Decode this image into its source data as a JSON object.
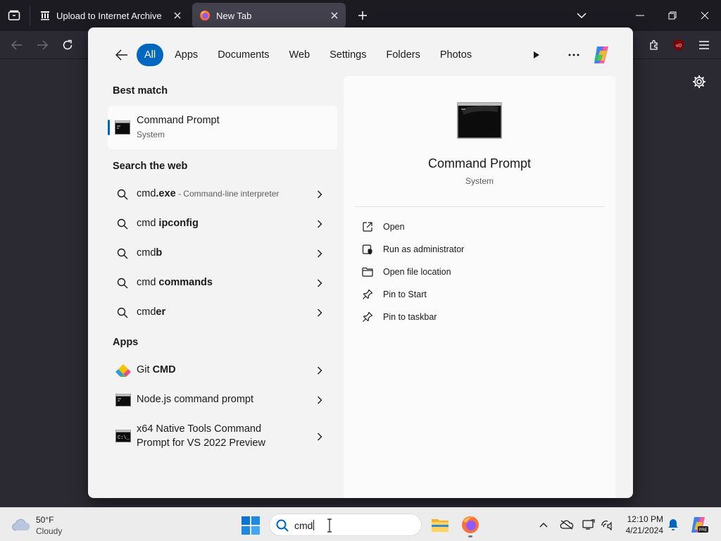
{
  "browser": {
    "tabs": [
      {
        "label": "Upload to Internet Archive",
        "icon": "archive-icon",
        "active": false
      },
      {
        "label": "New Tab",
        "icon": "firefox-icon",
        "active": true
      }
    ]
  },
  "search_panel": {
    "filters": [
      "All",
      "Apps",
      "Documents",
      "Web",
      "Settings",
      "Folders",
      "Photos"
    ],
    "active_filter": "All",
    "best_match": {
      "heading": "Best match",
      "title": "Command Prompt",
      "subtitle": "System"
    },
    "web": {
      "heading": "Search the web",
      "items": [
        {
          "prefix": "cmd",
          "bold": ".exe",
          "desc": " - Command-line interpreter"
        },
        {
          "prefix": "cmd ",
          "bold": "ipconfig",
          "desc": ""
        },
        {
          "prefix": "cmd",
          "bold": "b",
          "desc": ""
        },
        {
          "prefix": "cmd ",
          "bold": "commands",
          "desc": ""
        },
        {
          "prefix": "cmd",
          "bold": "er",
          "desc": ""
        }
      ]
    },
    "apps": {
      "heading": "Apps",
      "items": [
        {
          "prefix": "Git ",
          "bold": "CMD",
          "rest": "",
          "icon": "git-icon"
        },
        {
          "prefix": "Node.js command prompt",
          "bold": "",
          "rest": "",
          "icon": "console-icon"
        },
        {
          "prefix": "x64 Native Tools Command Prompt for VS 2022 Preview",
          "bold": "",
          "rest": "",
          "icon": "console-icon"
        }
      ]
    },
    "detail": {
      "title": "Command Prompt",
      "subtitle": "System",
      "actions": [
        {
          "label": "Open",
          "icon": "open-external-icon"
        },
        {
          "label": "Run as administrator",
          "icon": "shield-icon"
        },
        {
          "label": "Open file location",
          "icon": "folder-icon"
        },
        {
          "label": "Pin to Start",
          "icon": "pin-icon"
        },
        {
          "label": "Pin to taskbar",
          "icon": "pin-icon"
        }
      ]
    }
  },
  "taskbar": {
    "weather": {
      "temp": "50°F",
      "condition": "Cloudy"
    },
    "search_value": "cmd",
    "clock": {
      "time": "12:10 PM",
      "date": "4/21/2024"
    }
  },
  "colors": {
    "accent": "#0067c0",
    "chrome_dark": "#1c1b22",
    "panel_bg": "#f3f3f3"
  }
}
